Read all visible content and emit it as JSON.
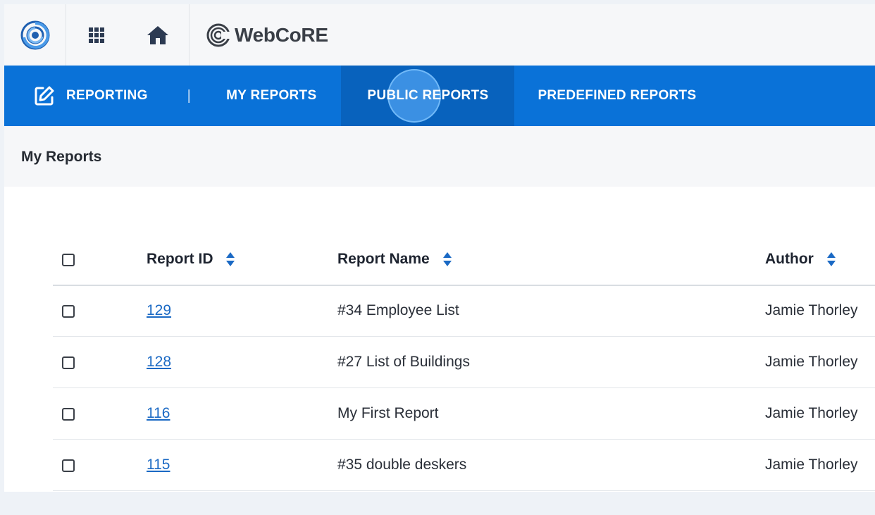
{
  "header": {
    "brand_name": "WebCoRE"
  },
  "nav": {
    "reporting": "REPORTING",
    "separator": "|",
    "my_reports": "MY REPORTS",
    "public_reports": "PUBLIC REPORTS",
    "predefined_reports": "PREDEFINED REPORTS"
  },
  "page": {
    "title": "My Reports"
  },
  "table": {
    "columns": {
      "id": "Report ID",
      "name": "Report Name",
      "author": "Author"
    },
    "rows": [
      {
        "id": "129",
        "name": "#34 Employee List",
        "author": "Jamie Thorley"
      },
      {
        "id": "128",
        "name": "#27 List of Buildings",
        "author": "Jamie Thorley"
      },
      {
        "id": "116",
        "name": "My First Report",
        "author": "Jamie Thorley"
      },
      {
        "id": "115",
        "name": "#35 double deskers",
        "author": "Jamie Thorley"
      }
    ]
  },
  "colors": {
    "nav_bg": "#0a72d8",
    "nav_active_bg": "#0862bd",
    "link": "#1a69c4",
    "sort_icon": "#1a69c4"
  }
}
